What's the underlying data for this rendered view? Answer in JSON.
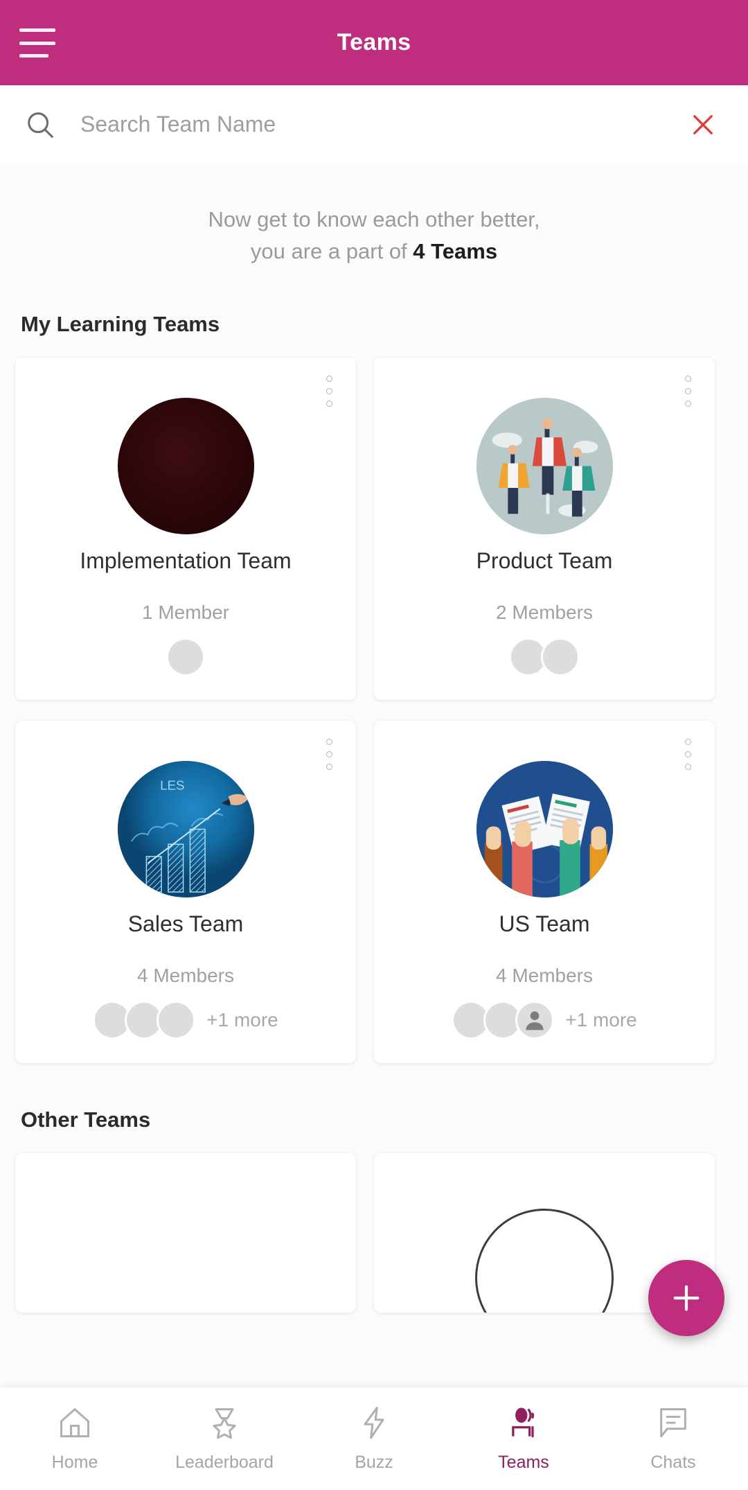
{
  "theme": {
    "brand": "#bf2d7e",
    "brand_dark": "#8f1f5e",
    "close_red": "#e23b3b",
    "muted_text": "#9a9a9a",
    "title_text": "#2b2b2b"
  },
  "appbar": {
    "title": "Teams",
    "menu_icon": "hamburger-menu-icon"
  },
  "search": {
    "placeholder": "Search Team Name",
    "value": "",
    "search_icon": "search-icon",
    "clear_icon": "close-icon"
  },
  "intro": {
    "line1": "Now get to know each other better,",
    "line2_prefix": "you are a part of ",
    "line2_strong": "4 Teams"
  },
  "sections": [
    {
      "title": "My Learning Teams"
    },
    {
      "title": "Other Teams"
    }
  ],
  "my_teams": [
    {
      "name": "Implementation Team",
      "member_count_label": "1 Member",
      "illustration": "dark-maroon-circle-image",
      "more_label": "",
      "avatars": [
        "man-photo-1"
      ]
    },
    {
      "name": "Product Team",
      "member_count_label": "2 Members",
      "illustration": "flying-superhero-businessmen-image",
      "more_label": "",
      "avatars": [
        "man-photo-1",
        "man-photo-3"
      ]
    },
    {
      "name": "Sales Team",
      "member_count_label": "4 Members",
      "illustration": "sales-bar-chart-image",
      "more_label": "+1 more",
      "avatars": [
        "man-photo-1",
        "man-photo-2",
        "woman-photo-1"
      ]
    },
    {
      "name": "US Team",
      "member_count_label": "4 Members",
      "illustration": "hands-holding-documents-image",
      "more_label": "+1 more",
      "avatars": [
        "man-photo-1",
        "man-photo-3",
        "default-person-avatar"
      ]
    }
  ],
  "fab": {
    "label": "+",
    "icon": "plus-icon"
  },
  "bottom_nav": {
    "active": "Teams",
    "items": [
      {
        "label": "Home",
        "icon": "home-icon"
      },
      {
        "label": "Leaderboard",
        "icon": "medal-icon"
      },
      {
        "label": "Buzz",
        "icon": "lightning-bolt-icon"
      },
      {
        "label": "Teams",
        "icon": "people-icon"
      },
      {
        "label": "Chats",
        "icon": "chat-bubble-icon"
      }
    ]
  }
}
